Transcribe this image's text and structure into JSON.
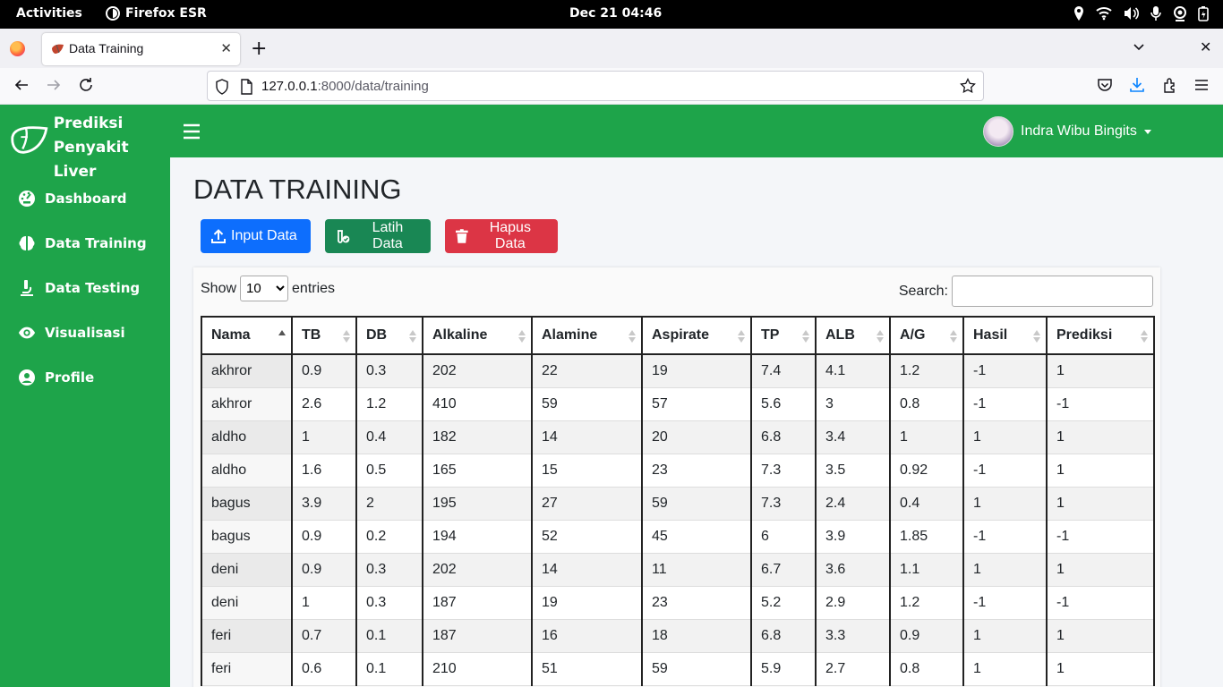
{
  "system": {
    "activities": "Activities",
    "app_name": "Firefox ESR",
    "clock": "Dec 21  04:46"
  },
  "browser": {
    "tab_title": "Data Training",
    "url_host": "127.0.0.1",
    "url_path": ":8000/data/training"
  },
  "brand": {
    "line1": "Prediksi",
    "line2": "Penyakit Liver",
    "color": "#1ea44a"
  },
  "sidebar": {
    "items": [
      {
        "label": "Dashboard",
        "icon": "dashboard-icon"
      },
      {
        "label": "Data Training",
        "icon": "brain-icon"
      },
      {
        "label": "Data Testing",
        "icon": "microscope-icon"
      },
      {
        "label": "Visualisasi",
        "icon": "eye-icon"
      },
      {
        "label": "Profile",
        "icon": "user-icon"
      }
    ]
  },
  "header": {
    "user_name": "Indra Wibu Bingits"
  },
  "page": {
    "title": "DATA TRAINING",
    "buttons": {
      "input": "Input Data",
      "train": "Latih Data",
      "delete": "Hapus Data"
    }
  },
  "datatable": {
    "show_label": "Show",
    "entries_label": "entries",
    "page_length": "10",
    "search_label": "Search:",
    "columns": [
      "Nama",
      "TB",
      "DB",
      "Alkaline",
      "Alamine",
      "Aspirate",
      "TP",
      "ALB",
      "A/G",
      "Hasil",
      "Prediksi"
    ],
    "rows": [
      [
        "akhror",
        "0.9",
        "0.3",
        "202",
        "22",
        "19",
        "7.4",
        "4.1",
        "1.2",
        "-1",
        "1"
      ],
      [
        "akhror",
        "2.6",
        "1.2",
        "410",
        "59",
        "57",
        "5.6",
        "3",
        "0.8",
        "-1",
        "-1"
      ],
      [
        "aldho",
        "1",
        "0.4",
        "182",
        "14",
        "20",
        "6.8",
        "3.4",
        "1",
        "1",
        "1"
      ],
      [
        "aldho",
        "1.6",
        "0.5",
        "165",
        "15",
        "23",
        "7.3",
        "3.5",
        "0.92",
        "-1",
        "1"
      ],
      [
        "bagus",
        "3.9",
        "2",
        "195",
        "27",
        "59",
        "7.3",
        "2.4",
        "0.4",
        "1",
        "1"
      ],
      [
        "bagus",
        "0.9",
        "0.2",
        "194",
        "52",
        "45",
        "6",
        "3.9",
        "1.85",
        "-1",
        "-1"
      ],
      [
        "deni",
        "0.9",
        "0.3",
        "202",
        "14",
        "11",
        "6.7",
        "3.6",
        "1.1",
        "1",
        "1"
      ],
      [
        "deni",
        "1",
        "0.3",
        "187",
        "19",
        "23",
        "5.2",
        "2.9",
        "1.2",
        "-1",
        "-1"
      ],
      [
        "feri",
        "0.7",
        "0.1",
        "187",
        "16",
        "18",
        "6.8",
        "3.3",
        "0.9",
        "1",
        "1"
      ],
      [
        "feri",
        "0.6",
        "0.1",
        "210",
        "51",
        "59",
        "5.9",
        "2.7",
        "0.8",
        "1",
        "1"
      ]
    ]
  }
}
